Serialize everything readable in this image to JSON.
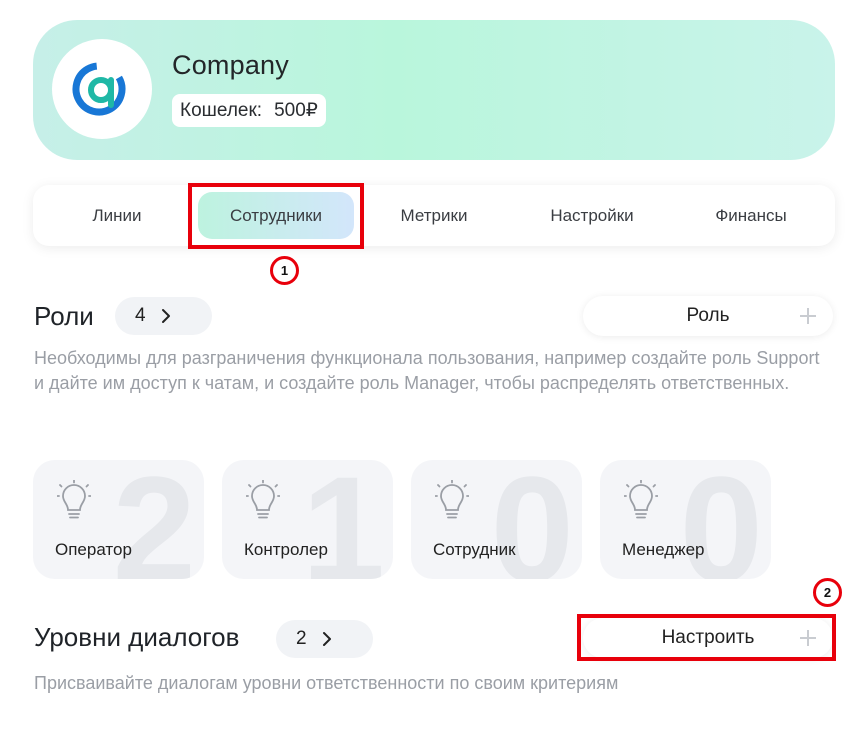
{
  "company": {
    "name": "Company",
    "wallet_label": "Кошелек:",
    "wallet_value": "500₽"
  },
  "tabs": [
    {
      "label": "Линии"
    },
    {
      "label": "Сотрудники",
      "active": true
    },
    {
      "label": "Метрики"
    },
    {
      "label": "Настройки"
    },
    {
      "label": "Финансы"
    }
  ],
  "annotations": {
    "marker_1": "1",
    "marker_2": "2",
    "highlight_color": "#e8000b"
  },
  "roles": {
    "title": "Роли",
    "count": "4",
    "add_button_label": "Роль",
    "description": "Необходимы для разграничения функционала пользования, например создайте роль Support и дайте им доступ к чатам, и создайте роль Manager, чтобы распределять ответственных.",
    "items": [
      {
        "name": "Оператор",
        "count": "2"
      },
      {
        "name": "Контролер",
        "count": "1"
      },
      {
        "name": "Сотрудник",
        "count": "0"
      },
      {
        "name": "Менеджер",
        "count": "0"
      }
    ]
  },
  "dialog_levels": {
    "title": "Уровни диалогов",
    "count": "2",
    "configure_button_label": "Настроить",
    "description": "Присваивайте диалогам уровни ответственности по своим критериям"
  },
  "colors": {
    "accent_teal": "#1fb8a6",
    "accent_blue": "#1877d6",
    "card_bg": "#f4f5f8",
    "muted_text": "#9a9ea5"
  }
}
